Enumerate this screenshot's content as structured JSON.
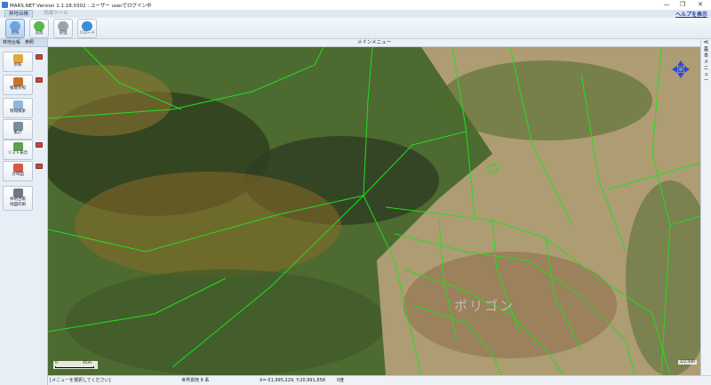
{
  "window": {
    "title": "MARS.NET Version 1.1.18.0302 : ユーザー userでログイン中",
    "controls": {
      "minimize": "—",
      "restore": "❐",
      "close": "✕"
    }
  },
  "tabs": [
    {
      "label": "林地台帳",
      "active": true
    },
    {
      "label": "汎用ツール",
      "active": false
    }
  ],
  "help_link": "ヘルプを表示",
  "ribbon": {
    "buttons": [
      {
        "label": "参照",
        "icon": "map-search-icon",
        "color": "#6aa6e0",
        "active": true
      },
      {
        "label": "追加",
        "icon": "add-icon",
        "color": "#59b84a",
        "active": false
      },
      {
        "label": "管理",
        "icon": "gear-icon",
        "color": "#9aa3ad",
        "active": false
      },
      {
        "label": "リロード",
        "icon": "reload-icon",
        "color": "#3b8ed6",
        "active": false
      }
    ]
  },
  "sidebar": {
    "header": "林地台帳　参照",
    "buttons": [
      {
        "label": "参照",
        "icon": "folder-icon",
        "color": "#e1a93a",
        "pin": true
      },
      {
        "label": "複数参照",
        "icon": "stack-icon",
        "color": "#c6732f",
        "pin": true
      },
      {
        "label": "情報検索",
        "icon": "magnifier-icon",
        "color": "#8fb6dc",
        "pin": false
      },
      {
        "label": "集計",
        "icon": "calculator-icon",
        "color": "#7e8c99",
        "pin": false
      },
      {
        "label": "リスト表示",
        "icon": "list-icon",
        "color": "#5fa04e",
        "pin": true
      },
      {
        "label": "分布図",
        "icon": "distribution-icon",
        "color": "#d6584a",
        "pin": true
      },
      {
        "label": "林地台帳\n地図印刷",
        "icon": "printer-icon",
        "color": "#6c7886",
        "pin": false
      }
    ]
  },
  "map": {
    "header": "メインメニュー",
    "watermark": "ポリゴン",
    "scale": {
      "start": "0",
      "end": "45m"
    },
    "scale_ratio": "1/2,500",
    "colors": {
      "parcel_lines": "#22dd22",
      "forest": "#3f5a2a",
      "field": "#b9a27a"
    }
  },
  "right_panel": {
    "collapse": "≪",
    "label": "基本メニュー"
  },
  "status": {
    "message": "[メニューを選択してください]",
    "crs": "世界測地 8 系",
    "coords": "X=-51,995,229,  Y:20,991,858",
    "angle": "0度"
  }
}
